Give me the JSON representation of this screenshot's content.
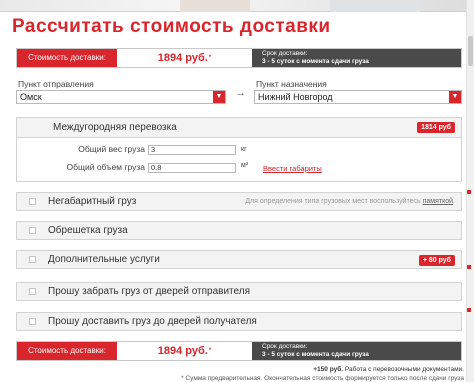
{
  "title": "Рассчитать стоимость доставки",
  "price_bar": {
    "label": "Стоимость доставки:",
    "amount": "1894 руб.",
    "asterisk": "*",
    "term_label": "Срок доставки:",
    "term_value": "3 - 5 суток с момента сдачи груза"
  },
  "origin": {
    "label": "Пункт отправления",
    "value": "Омск"
  },
  "destination": {
    "label": "Пункт назначения",
    "value": "Нижний Новгород"
  },
  "route_arrow": "→",
  "intercity": {
    "title": "Междугородняя перевозка",
    "badge": "1814 руб",
    "weight_label": "Общий вес груза",
    "weight_value": "3",
    "weight_unit": "кг",
    "volume_label": "Общий объем груза",
    "volume_value": "0.8",
    "volume_unit": "м³",
    "dims_link": "Ввести габариты"
  },
  "options": [
    {
      "label": "Негабаритный груз",
      "hint_prefix": "Для определения типа грузовых мест воспользуйтесь ",
      "hint_link": "памяткой",
      "hint_suffix": "."
    },
    {
      "label": "Обрешетка груза"
    },
    {
      "label": "Дополнительные услуги",
      "badge": "+ 80 руб"
    },
    {
      "label": "Прошу забрать груз от дверей отправителя"
    },
    {
      "label": "Прошу доставить груз до дверей получателя"
    }
  ],
  "footnotes": {
    "docs_amount": "+150 руб.",
    "docs_text": "Работа с перевозочными документами.",
    "disclaimer": "* Сумма предварительная. Окончательная стоимость формируется только после сдачи груза"
  },
  "colors": {
    "accent": "#d9252c",
    "term_bg": "#4a4a4a",
    "panel_bg": "#f3f3f3"
  },
  "icons": {
    "select_arrow": "chevron-down-icon",
    "route": "arrow-right-icon"
  }
}
